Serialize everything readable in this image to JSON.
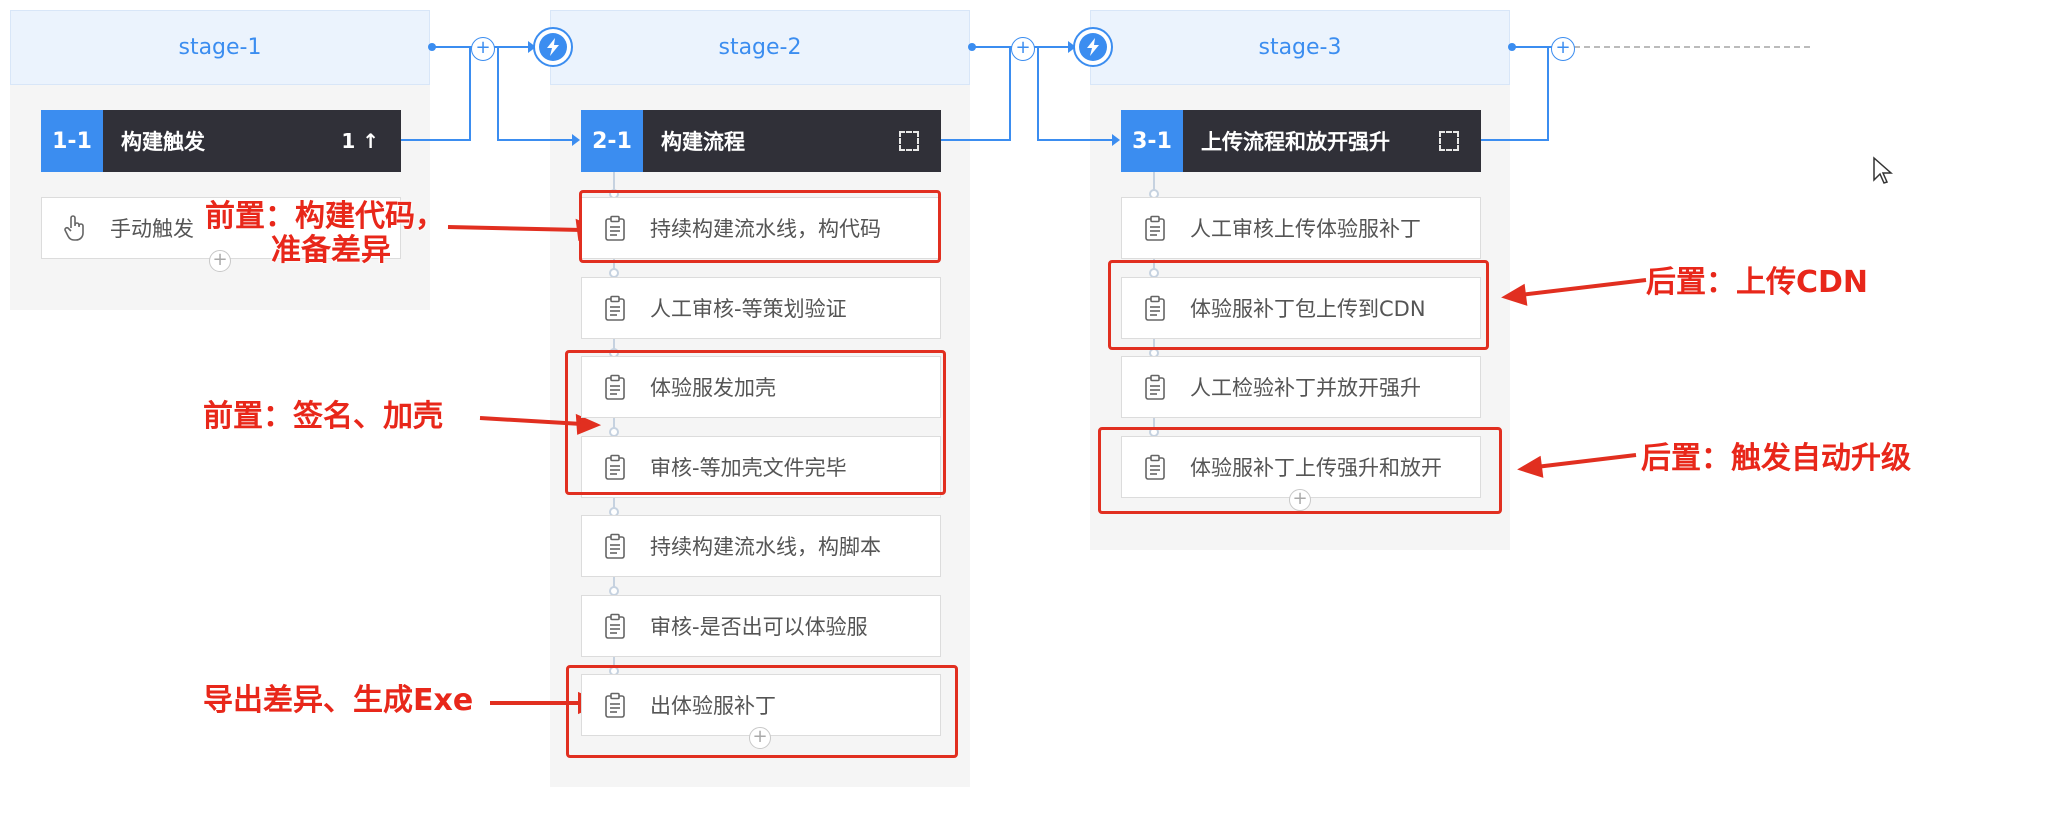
{
  "stages": [
    {
      "name": "stage-1",
      "job": {
        "id": "1-1",
        "name": "构建触发",
        "extra": "1 ↑"
      },
      "tasks": [
        {
          "label": "手动触发",
          "icon": "hand-pointer-icon"
        }
      ]
    },
    {
      "name": "stage-2",
      "job": {
        "id": "2-1",
        "name": "构建流程"
      },
      "tasks": [
        {
          "label": "持续构建流水线，构代码",
          "icon": "clipboard-icon"
        },
        {
          "label": "人工审核-等策划验证",
          "icon": "clipboard-icon"
        },
        {
          "label": "体验服发加壳",
          "icon": "clipboard-icon"
        },
        {
          "label": "审核-等加壳文件完毕",
          "icon": "clipboard-icon"
        },
        {
          "label": "持续构建流水线，构脚本",
          "icon": "clipboard-icon"
        },
        {
          "label": "审核-是否出可以体验服",
          "icon": "clipboard-icon"
        },
        {
          "label": "出体验服补丁",
          "icon": "clipboard-icon"
        }
      ]
    },
    {
      "name": "stage-3",
      "job": {
        "id": "3-1",
        "name": "上传流程和放开强升"
      },
      "tasks": [
        {
          "label": "人工审核上传体验服补丁",
          "icon": "clipboard-icon"
        },
        {
          "label": "体验服补丁包上传到CDN",
          "icon": "clipboard-icon"
        },
        {
          "label": "人工检验补丁并放开强升",
          "icon": "clipboard-icon"
        },
        {
          "label": "体验服补丁上传强升和放开",
          "icon": "clipboard-icon"
        }
      ]
    }
  ],
  "annotations": {
    "a1_line1": "前置：构建代码，",
    "a1_line2": "准备差异",
    "a2": "前置：签名、加壳",
    "a3": "导出差异、生成Exe",
    "a4": "后置：上传CDN",
    "a5": "后置：触发自动升级"
  },
  "colors": {
    "accent": "#3b8df0",
    "job_header": "#303038",
    "annotation_red": "#e12f20",
    "stage_header_bg": "#ebf3fd"
  }
}
